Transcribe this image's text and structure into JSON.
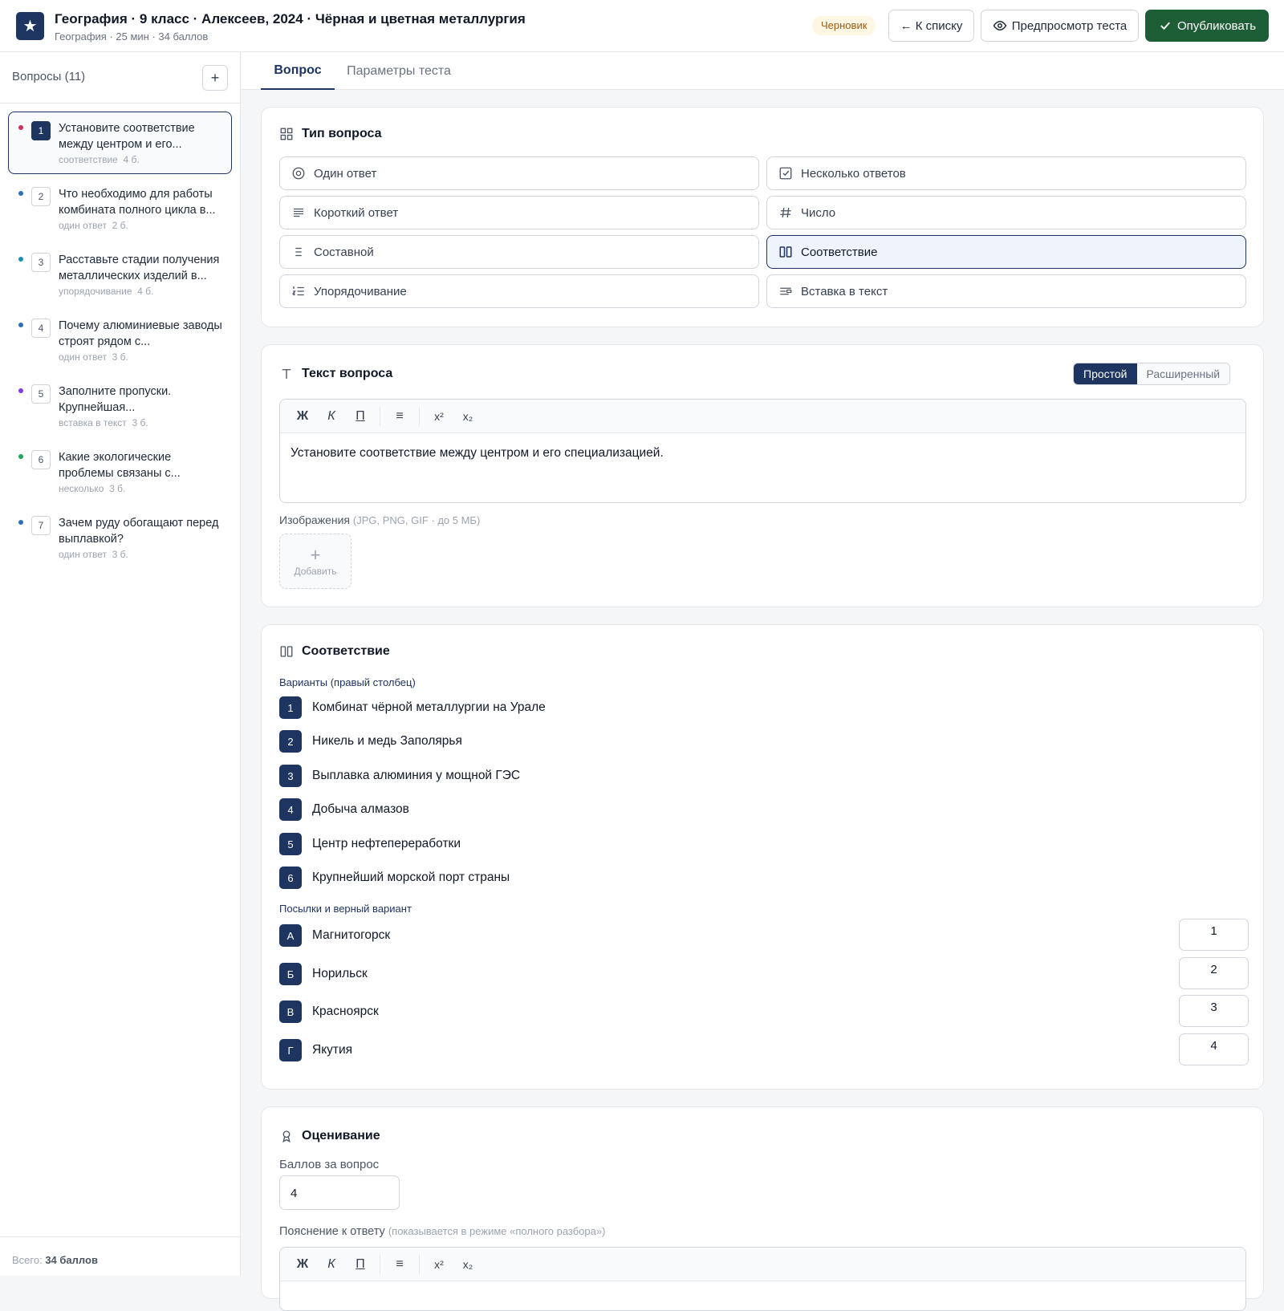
{
  "header": {
    "logo_glyph": "★",
    "title": "География · 9 класс · Алексеев, 2024 · Чёрная и цветная металлургия",
    "subtitle": "География · 25 мин · 34 баллов",
    "status_badge": "Черновик",
    "back_label": "← К списку",
    "preview_label": "Предпросмотр теста",
    "publish_label": "Опубликовать"
  },
  "sidebar": {
    "title": "Вопросы (11)",
    "add_glyph": "+",
    "items": [
      {
        "num": "1",
        "text": "Установите соответствие между центром и его...",
        "type": "соответствие",
        "points": "4 б.",
        "dot": "#d12f5c"
      },
      {
        "num": "2",
        "text": "Что необходимо для работы комбината полного цикла в...",
        "type": "один ответ",
        "points": "2 б.",
        "dot": "#2f6fb5"
      },
      {
        "num": "3",
        "text": "Расставьте стадии получения металлических изделий в...",
        "type": "упорядочивание",
        "points": "4 б.",
        "dot": "#1b8fb3"
      },
      {
        "num": "4",
        "text": "Почему алюминиевые заводы строят рядом с...",
        "type": "один ответ",
        "points": "3 б.",
        "dot": "#2f6fb5"
      },
      {
        "num": "5",
        "text": "Заполните пропуски. Крупнейшая...",
        "type": "вставка в текст",
        "points": "3 б.",
        "dot": "#7c3aed"
      },
      {
        "num": "6",
        "text": "Какие экологические проблемы связаны с...",
        "type": "несколько",
        "points": "3 б.",
        "dot": "#22a35a"
      },
      {
        "num": "7",
        "text": "Зачем руду обогащают перед выплавкой?",
        "type": "один ответ",
        "points": "3 б.",
        "dot": "#2f6fb5"
      }
    ],
    "total_label": "Всего:",
    "total_value": "34 баллов"
  },
  "tabs": {
    "question": "Вопрос",
    "params": "Параметры теста"
  },
  "question_type": {
    "title": "Тип вопроса",
    "options": [
      {
        "label": "Один ответ",
        "icon": "radio-icon"
      },
      {
        "label": "Несколько ответов",
        "icon": "checkbox-icon"
      },
      {
        "label": "Короткий ответ",
        "icon": "short-text-icon"
      },
      {
        "label": "Число",
        "icon": "hash-icon"
      },
      {
        "label": "Составной",
        "icon": "list-icon"
      },
      {
        "label": "Соответствие",
        "icon": "columns-icon"
      },
      {
        "label": "Упорядочивание",
        "icon": "ordered-list-icon"
      },
      {
        "label": "Вставка в текст",
        "icon": "insert-text-icon"
      }
    ],
    "selected": "Соответствие"
  },
  "question_text": {
    "title": "Текст вопроса",
    "mode_simple": "Простой",
    "mode_advanced": "Расширенный",
    "toolbar": {
      "bold": "Ж",
      "italic": "К",
      "underline": "П",
      "list": "≡",
      "sup": "x²",
      "sub": "x₂"
    },
    "content": "Установите соответствие между центром и его специализацией.",
    "images_label": "Изображения",
    "images_hint": "(JPG, PNG, GIF · до 5 МБ)",
    "add_image_label": "Добавить"
  },
  "matching": {
    "title": "Соответствие",
    "options_label": "Варианты (правый столбец)",
    "options": [
      {
        "num": "1",
        "text": "Комбинат чёрной металлургии на Урале"
      },
      {
        "num": "2",
        "text": "Никель и медь Заполярья"
      },
      {
        "num": "3",
        "text": "Выплавка алюминия у мощной ГЭС"
      },
      {
        "num": "4",
        "text": "Добыча алмазов"
      },
      {
        "num": "5",
        "text": "Центр нефтепереработки"
      },
      {
        "num": "6",
        "text": "Крупнейший морской порт страны"
      }
    ],
    "premises_label": "Посылки и верный вариант",
    "premises": [
      {
        "letter": "А",
        "text": "Магнитогорск",
        "answer": "1"
      },
      {
        "letter": "Б",
        "text": "Норильск",
        "answer": "2"
      },
      {
        "letter": "В",
        "text": "Красноярск",
        "answer": "3"
      },
      {
        "letter": "Г",
        "text": "Якутия",
        "answer": "4"
      }
    ]
  },
  "grading": {
    "title": "Оценивание",
    "points_label": "Баллов за вопрос",
    "points_value": "4",
    "explanation_label": "Пояснение к ответу",
    "explanation_hint": "(показывается в режиме «полного разбора»)"
  },
  "colors": {
    "accent": "#1e3461",
    "publish": "#1d5e36",
    "draft_bg": "#fdf6e3",
    "draft_text": "#9a5b13"
  }
}
